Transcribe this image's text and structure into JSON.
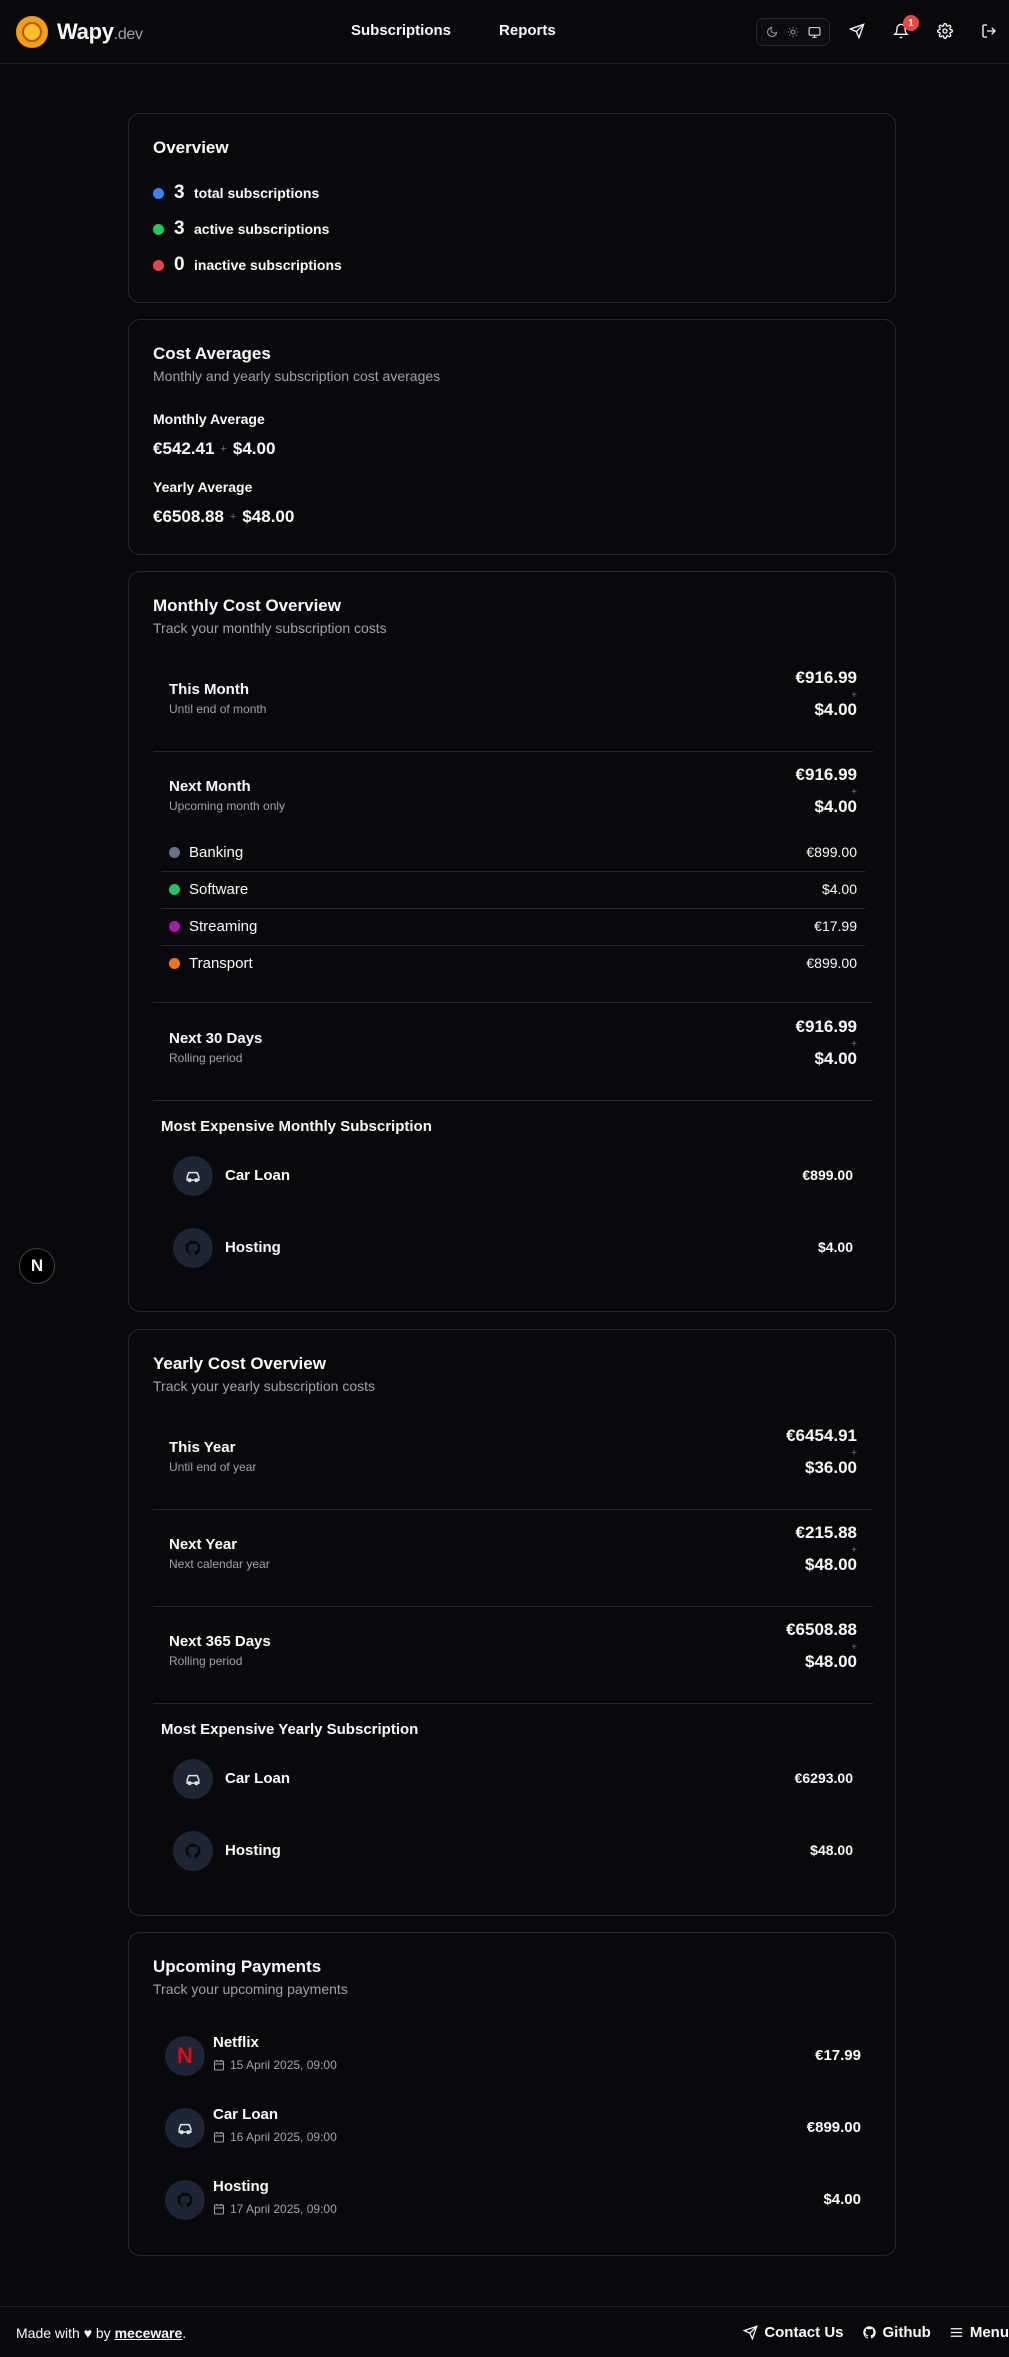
{
  "header": {
    "brand": "Wapy",
    "brand_suffix": ".dev",
    "nav": [
      "Subscriptions",
      "Reports"
    ],
    "notification_count": "1",
    "icons": [
      "moon-icon",
      "sun-icon",
      "monitor-icon",
      "send-icon",
      "bell-icon",
      "gear-icon",
      "logout-icon"
    ]
  },
  "overview": {
    "title": "Overview",
    "rows": [
      {
        "count": "3",
        "label": "total subscriptions",
        "color": "#3b82f6"
      },
      {
        "count": "3",
        "label": "active subscriptions",
        "color": "#22c55e"
      },
      {
        "count": "0",
        "label": "inactive subscriptions",
        "color": "#ef4444"
      }
    ]
  },
  "averages": {
    "title": "Cost Averages",
    "subtitle": "Monthly and yearly subscription cost averages",
    "monthly_label": "Monthly Average",
    "monthly_eur": "€542.41",
    "monthly_usd": "$4.00",
    "yearly_label": "Yearly Average",
    "yearly_eur": "€6508.88",
    "yearly_usd": "$48.00",
    "plus": "+"
  },
  "monthly": {
    "title": "Monthly Cost Overview",
    "subtitle": "Track your monthly subscription costs",
    "this_month": {
      "title": "This Month",
      "sub": "Until end of month",
      "eur": "€916.99",
      "usd": "$4.00"
    },
    "next_month": {
      "title": "Next Month",
      "sub": "Upcoming month only",
      "eur": "€916.99",
      "usd": "$4.00"
    },
    "categories": [
      {
        "name": "Banking",
        "value": "€899.00",
        "color": "#64748b"
      },
      {
        "name": "Software",
        "value": "$4.00",
        "color": "#22c55e"
      },
      {
        "name": "Streaming",
        "value": "€17.99",
        "color": "#a21caf"
      },
      {
        "name": "Transport",
        "value": "€899.00",
        "color": "#f97316"
      }
    ],
    "next_30": {
      "title": "Next 30 Days",
      "sub": "Rolling period",
      "eur": "€916.99",
      "usd": "$4.00"
    },
    "most_expensive_title": "Most Expensive Monthly Subscription",
    "most_expensive": [
      {
        "name": "Car Loan",
        "value": "€899.00",
        "icon": "car-icon"
      },
      {
        "name": "Hosting",
        "value": "$4.00",
        "icon": "github-icon"
      }
    ]
  },
  "yearly": {
    "title": "Yearly Cost Overview",
    "subtitle": "Track your yearly subscription costs",
    "this_year": {
      "title": "This Year",
      "sub": "Until end of year",
      "eur": "€6454.91",
      "usd": "$36.00"
    },
    "next_year": {
      "title": "Next Year",
      "sub": "Next calendar year",
      "eur": "€215.88",
      "usd": "$48.00"
    },
    "next_365": {
      "title": "Next 365 Days",
      "sub": "Rolling period",
      "eur": "€6508.88",
      "usd": "$48.00"
    },
    "most_expensive_title": "Most Expensive Yearly Subscription",
    "most_expensive": [
      {
        "name": "Car Loan",
        "value": "€6293.00",
        "icon": "car-icon"
      },
      {
        "name": "Hosting",
        "value": "$48.00",
        "icon": "github-icon"
      }
    ]
  },
  "upcoming": {
    "title": "Upcoming Payments",
    "subtitle": "Track your upcoming payments",
    "items": [
      {
        "name": "Netflix",
        "date": "15 April 2025, 09:00",
        "value": "€17.99",
        "icon": "netflix-icon"
      },
      {
        "name": "Car Loan",
        "date": "16 April 2025, 09:00",
        "value": "€899.00",
        "icon": "car-icon"
      },
      {
        "name": "Hosting",
        "date": "17 April 2025, 09:00",
        "value": "$4.00",
        "icon": "github-icon"
      }
    ]
  },
  "misc": {
    "n_badge": "N"
  },
  "footer": {
    "made_prefix": "Made with ♥ by ",
    "author": "meceware",
    "made_suffix": ".",
    "links": [
      "Contact Us",
      "Github",
      "Menu"
    ]
  }
}
